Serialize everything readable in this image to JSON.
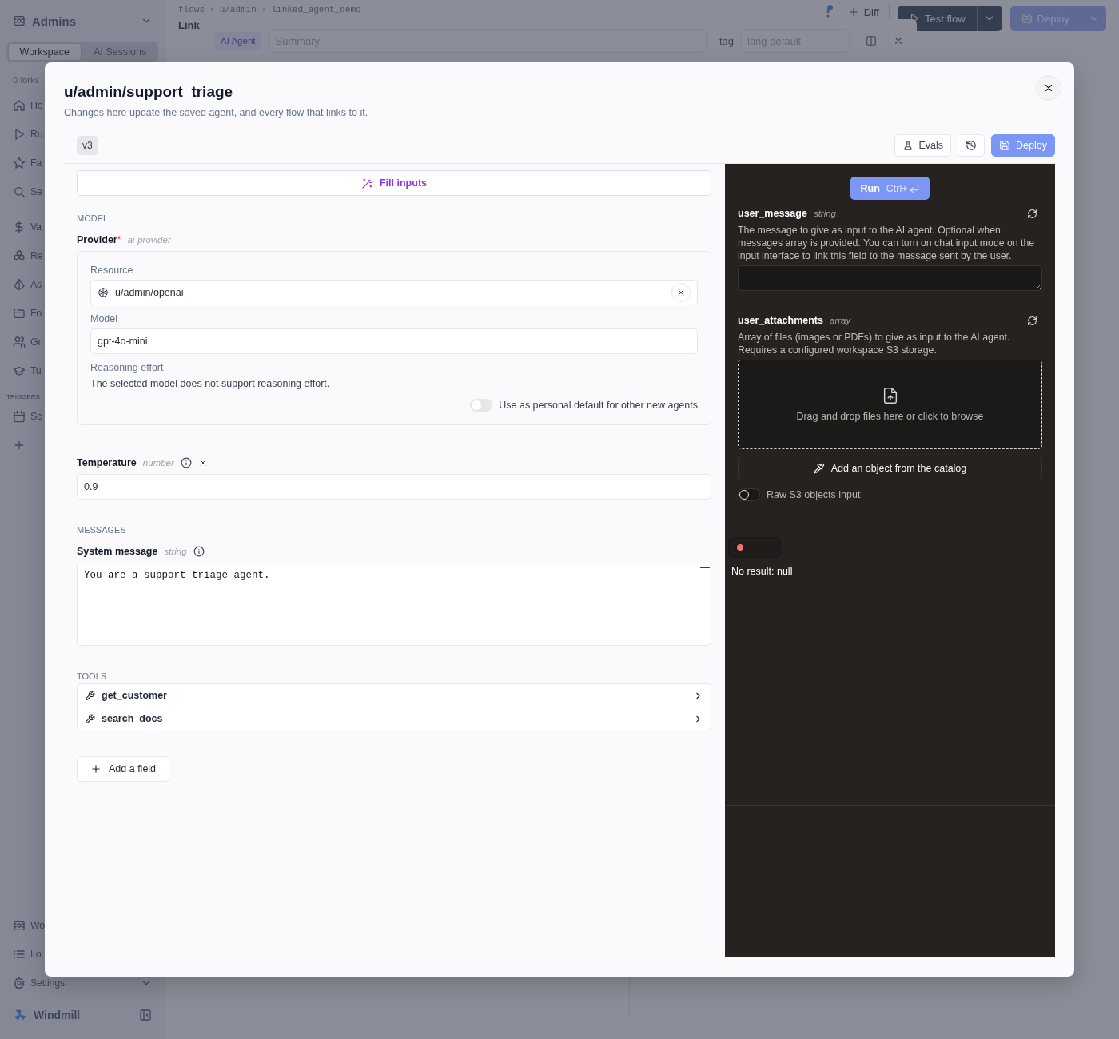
{
  "sidebar": {
    "workspace": "Admins",
    "tabs": [
      {
        "label": "Workspace",
        "selected": true
      },
      {
        "label": "AI Sessions",
        "selected": false
      }
    ],
    "forks": "0 forks",
    "items": [
      {
        "label": "Ho"
      },
      {
        "label": "Ru"
      },
      {
        "label": "Fa"
      },
      {
        "label": "Se"
      },
      {
        "label": "Va"
      },
      {
        "label": "Re"
      },
      {
        "label": "As"
      },
      {
        "label": "Fo"
      },
      {
        "label": "Gr"
      },
      {
        "label": "Tu"
      }
    ],
    "triggers_heading": "TRIGGERS",
    "trigger_items": [
      {
        "label": "Sc"
      }
    ],
    "bottom_items": [
      {
        "label": "Wo"
      },
      {
        "label": "Lo"
      },
      {
        "label": "Settings"
      }
    ],
    "brand": "Windmill"
  },
  "header": {
    "breadcrumb": [
      "flows",
      "u/admin",
      "linked_agent_demo"
    ],
    "breadcrumb_separator": "›",
    "title": "Link",
    "diff": "Diff",
    "test_flow": "Test flow",
    "deploy": "Deploy"
  },
  "flow_drawer": {
    "badge": "AI Agent",
    "summary": {
      "placeholder": "Summary"
    },
    "tag_label": "tag",
    "tag": {
      "placeholder": "lang default"
    }
  },
  "dialog": {
    "title": "u/admin/support_triage",
    "subtitle": "Changes here update the saved agent, and every flow that links to it.",
    "version": "v3",
    "evals": "Evals",
    "deploy": "Deploy",
    "fill_inputs": "Fill inputs",
    "model_heading": "MODEL",
    "provider": {
      "label": "Provider",
      "required_mark": "*",
      "type": "ai-provider",
      "resource_label": "Resource",
      "resource": "u/admin/openai",
      "model_label": "Model",
      "model": "gpt-4o-mini",
      "reasoning_label": "Reasoning effort",
      "reasoning_note": "The selected model does not support reasoning effort.",
      "personal_default": {
        "label": "Use as personal default for other new agents",
        "on": false
      }
    },
    "temperature": {
      "label": "Temperature",
      "type": "number",
      "value": "0.9"
    },
    "messages_heading": "MESSAGES",
    "system_message": {
      "label": "System message",
      "type": "string",
      "value": "You are a support triage agent."
    },
    "tools_heading": "TOOLS",
    "tools": [
      {
        "name": "get_customer"
      },
      {
        "name": "search_docs"
      }
    ],
    "add_field": "Add a field"
  },
  "test_panel": {
    "run": "Run",
    "shortcut": "Ctrl+",
    "inputs": [
      {
        "kind": "text",
        "name": "user_message",
        "type": "string",
        "description": "The message to give as input to the AI agent. Optional when messages array is provided. You can turn on chat input mode on the input interface to link this field to the message sent by the user."
      },
      {
        "kind": "files",
        "name": "user_attachments",
        "type": "array",
        "description": "Array of files (images or PDFs) to give as input to the AI agent. Requires a configured workspace S3 storage.",
        "dropzone": "Drag and drop files here or click to browse",
        "catalog": "Add an object from the catalog",
        "raw_toggle": {
          "label": "Raw S3 objects input",
          "on": false
        }
      }
    ],
    "result": "No result: null"
  }
}
